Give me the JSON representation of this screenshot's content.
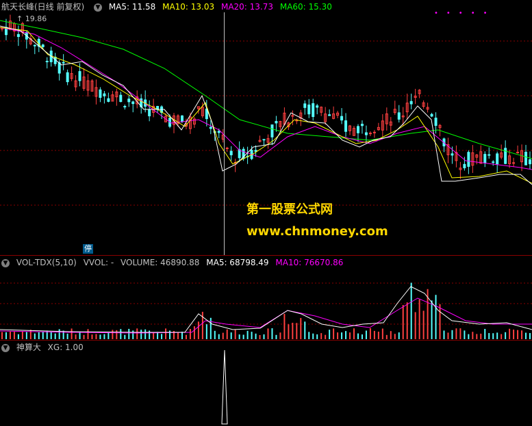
{
  "price_panel": {
    "stock_name": "航天长峰(日线 前复权)",
    "ma5": "MA5: 11.58",
    "ma10": "MA10: 13.03",
    "ma20": "MA20: 13.73",
    "ma60": "MA60: 15.30",
    "high_label": "19.86",
    "stop_badge": "停"
  },
  "volume_panel": {
    "indicator": "VOL-TDX(5,10)",
    "vvol": "VVOL: -",
    "volume": "VOLUME: 46890.88",
    "ma5": "MA5: 68798.49",
    "ma10": "MA10: 76670.86"
  },
  "xg_panel": {
    "indicator": "神算大",
    "xg": "XG: 1.00"
  },
  "watermark": {
    "line1": "第一股票公式网",
    "line2": "www.chnmoney.com"
  },
  "colors": {
    "up": "#ff4040",
    "down": "#54ffff",
    "ma5": "#ffffff",
    "ma10": "#ffff00",
    "ma20": "#ff00ff",
    "ma60": "#00ff00",
    "grid": "#8b0000"
  },
  "chart_data": {
    "type": "candlestick",
    "ma_price": [
      19.2,
      19.4,
      19.1,
      18.6,
      18.2,
      17.6,
      17.1,
      16.7,
      16.5,
      16.2,
      16.0,
      15.8,
      15.6,
      15.4,
      15.2,
      15.0,
      14.7,
      14.5,
      14.3,
      14.4,
      15.0,
      14.3,
      13.4,
      12.6,
      12.5,
      12.8,
      13.3,
      13.8,
      14.3,
      14.6,
      14.9,
      15.0,
      14.9,
      14.7,
      14.3,
      14.0,
      14.0,
      14.2,
      14.3,
      14.5,
      14.7,
      15.2,
      15.6,
      15.2,
      14.0,
      12.6,
      12.3,
      12.4,
      12.5,
      12.6,
      12.6,
      12.5,
      12.5,
      12.3
    ]
  }
}
